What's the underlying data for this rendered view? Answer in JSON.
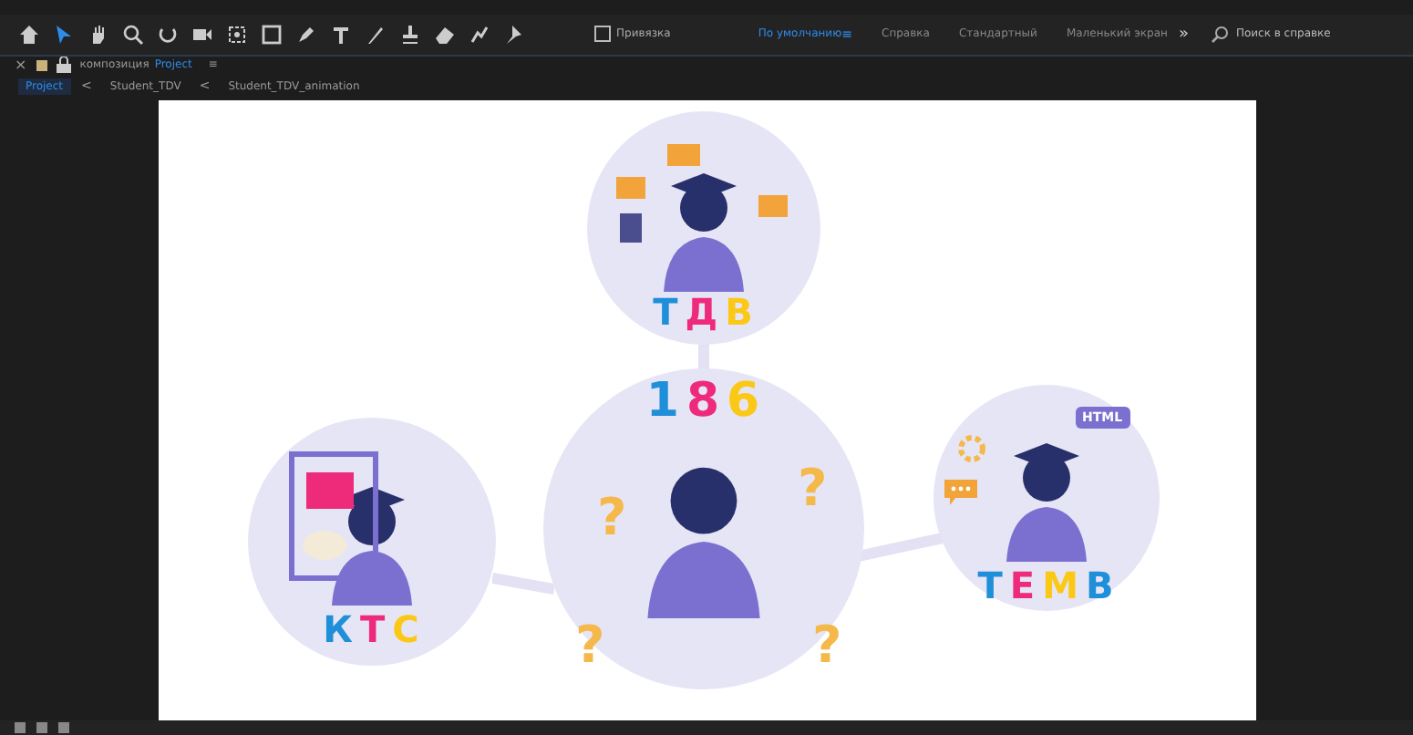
{
  "toolbar": {
    "tools": [
      {
        "selected": false
      },
      {
        "selected": true
      },
      {
        "selected": false
      },
      {
        "selected": false
      },
      {
        "selected": false
      },
      {
        "selected": false
      },
      {
        "selected": false
      },
      {
        "selected": false
      },
      {
        "selected": false
      },
      {
        "selected": false
      },
      {
        "selected": false
      },
      {
        "selected": false
      },
      {
        "selected": false
      },
      {
        "selected": false
      },
      {
        "selected": false
      }
    ],
    "snapping": {
      "label": "Привязка",
      "checked": false
    },
    "workspaces": [
      {
        "label": "По умолчанию",
        "selected": true
      },
      {
        "label": "Справка",
        "selected": false
      },
      {
        "label": "Стандартный",
        "selected": false
      },
      {
        "label": "Маленький экран",
        "selected": false
      }
    ],
    "workspace_menu": "≡",
    "more": "»",
    "search": {
      "placeholder": "Поиск в справке"
    }
  },
  "panel": {
    "close": "×",
    "title_prefix": "композиция",
    "title": "Project",
    "menu": "≡",
    "breadcrumbs": [
      {
        "label": "Project",
        "selected": true
      },
      {
        "label": "Student_TDV",
        "selected": false
      },
      {
        "label": "Student_TDV_animation",
        "selected": false
      }
    ],
    "separator": "<"
  },
  "composition": {
    "nodes": [
      {
        "kind": "teacher",
        "letters": [
          {
            "char": "Т",
            "color": "#1e8fd8"
          },
          {
            "char": "Д",
            "color": "#ee2a7b"
          },
          {
            "char": "В",
            "color": "#fbc816"
          }
        ]
      },
      {
        "kind": "artist",
        "letters": [
          {
            "char": "К",
            "color": "#1e8fd8"
          },
          {
            "char": "Т",
            "color": "#ee2a7b"
          },
          {
            "char": "С",
            "color": "#fbc816"
          }
        ]
      },
      {
        "kind": "student",
        "letters": [
          {
            "char": "1",
            "color": "#1e8fd8"
          },
          {
            "char": "8",
            "color": "#ee2a7b"
          },
          {
            "char": "6",
            "color": "#fbc816"
          }
        ],
        "marks": [
          "?",
          "?",
          "?",
          "?"
        ]
      },
      {
        "kind": "coder",
        "letters": [
          {
            "char": "Т",
            "color": "#1e8fd8"
          },
          {
            "char": "Е",
            "color": "#ee2a7b"
          },
          {
            "char": "М",
            "color": "#fbc816"
          },
          {
            "char": "В",
            "color": "#1e8fd8"
          }
        ],
        "bubble": "HTML"
      }
    ]
  }
}
